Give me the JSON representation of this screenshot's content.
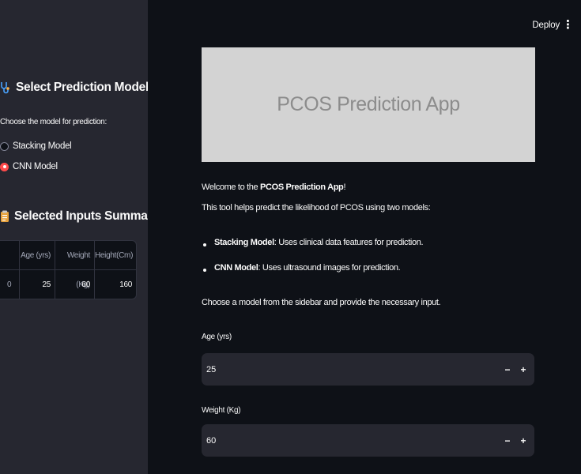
{
  "header": {
    "deploy_label": "Deploy",
    "menu_label": "⋮"
  },
  "sidebar": {
    "model_heading": "Select Prediction Model",
    "model_heading_icon": "stethoscope-icon",
    "model_caption": "Choose the model for prediction:",
    "model_options": [
      {
        "label": "Stacking Model",
        "selected": false
      },
      {
        "label": "CNN Model",
        "selected": true
      }
    ],
    "summary_heading": "Selected Inputs Summary",
    "summary_heading_icon": "clipboard-icon",
    "summary_table": {
      "columns": [
        "",
        "Age (yrs)",
        "Weight (Kg)",
        "Height(Cm)"
      ],
      "rows": [
        [
          "0",
          "25",
          "60",
          "160"
        ]
      ]
    }
  },
  "main": {
    "banner_text": "PCOS Prediction App",
    "welcome_prefix": "Welcome to the ",
    "welcome_bold": "PCOS Prediction App",
    "welcome_suffix": "!",
    "intro": "This tool helps predict the likelihood of PCOS using two models:",
    "bullets": [
      {
        "bold": "Stacking Model",
        "text": ": Uses clinical data features for prediction."
      },
      {
        "bold": "CNN Model",
        "text": ": Uses ultrasound images for prediction."
      }
    ],
    "instruction": "Choose a model from the sidebar and provide the necessary input.",
    "inputs": [
      {
        "label": "Age (yrs)",
        "value": "25",
        "minus": "−",
        "plus": "+"
      },
      {
        "label": "Weight (Kg)",
        "value": "60",
        "minus": "−",
        "plus": "+"
      }
    ]
  },
  "colors": {
    "sidebar_bg": "#262730",
    "main_bg": "#0e1117",
    "accent": "#ff4b4b",
    "banner_bg": "#d3d3d3",
    "input_bg": "#262730"
  }
}
